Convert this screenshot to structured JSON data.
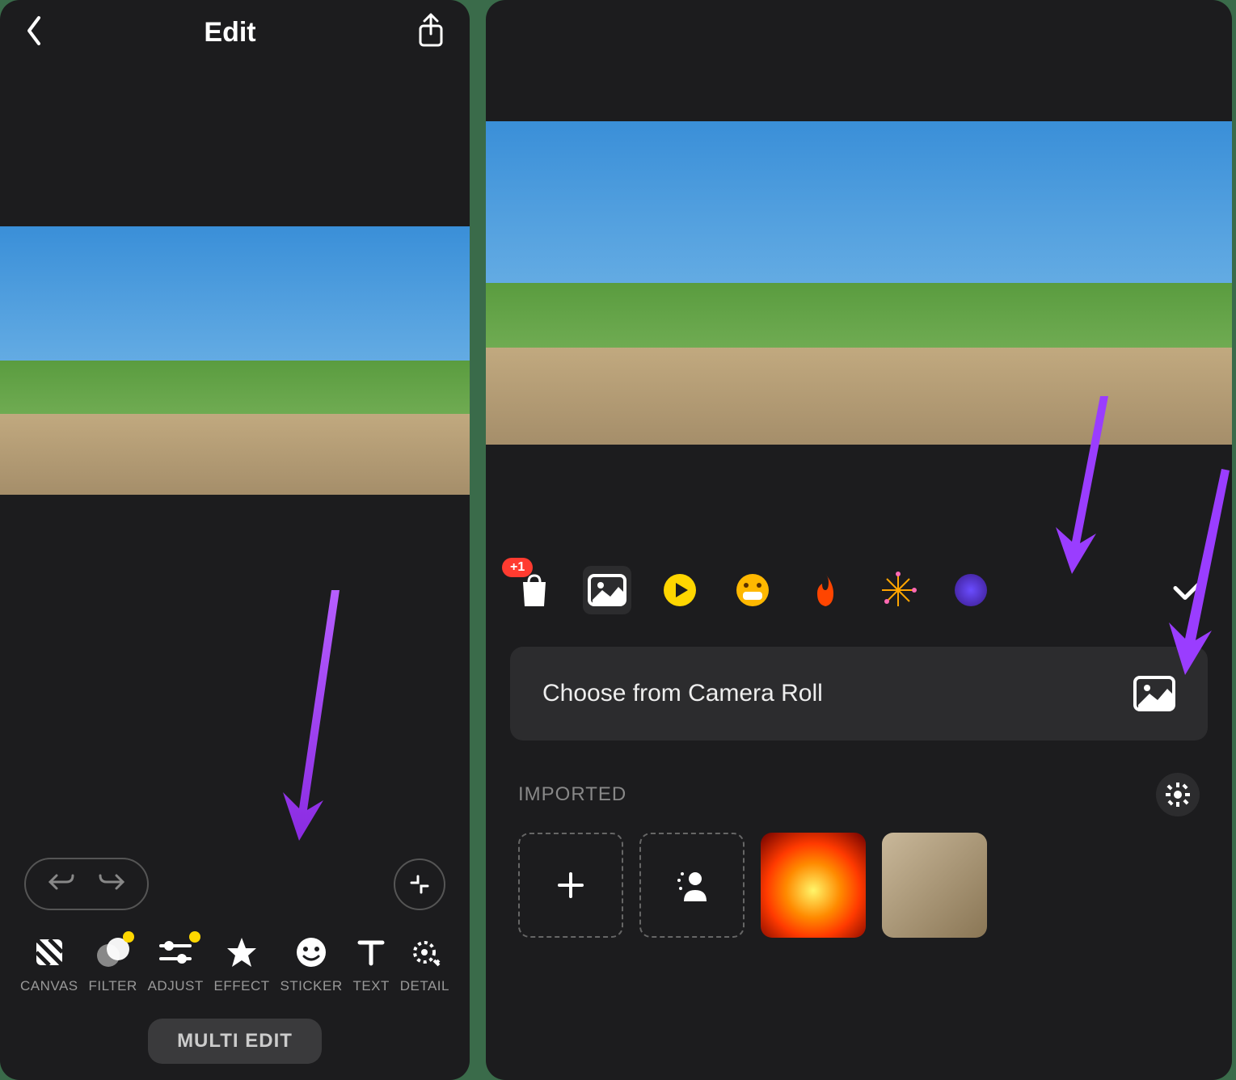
{
  "left": {
    "header": {
      "title": "Edit"
    },
    "tools": [
      {
        "id": "canvas",
        "label": "CANVAS",
        "dot": false
      },
      {
        "id": "filter",
        "label": "FILTER",
        "dot": true
      },
      {
        "id": "adjust",
        "label": "ADJUST",
        "dot": true
      },
      {
        "id": "effect",
        "label": "EFFECT",
        "dot": false
      },
      {
        "id": "sticker",
        "label": "STICKER",
        "dot": false
      },
      {
        "id": "text",
        "label": "TEXT",
        "dot": false
      },
      {
        "id": "detail",
        "label": "DETAIL",
        "dot": false
      }
    ],
    "multi_edit_label": "MULTI EDIT"
  },
  "right": {
    "categories": {
      "shop_badge": "+1"
    },
    "camera_roll_label": "Choose from Camera Roll",
    "imported_label": "IMPORTED"
  }
}
